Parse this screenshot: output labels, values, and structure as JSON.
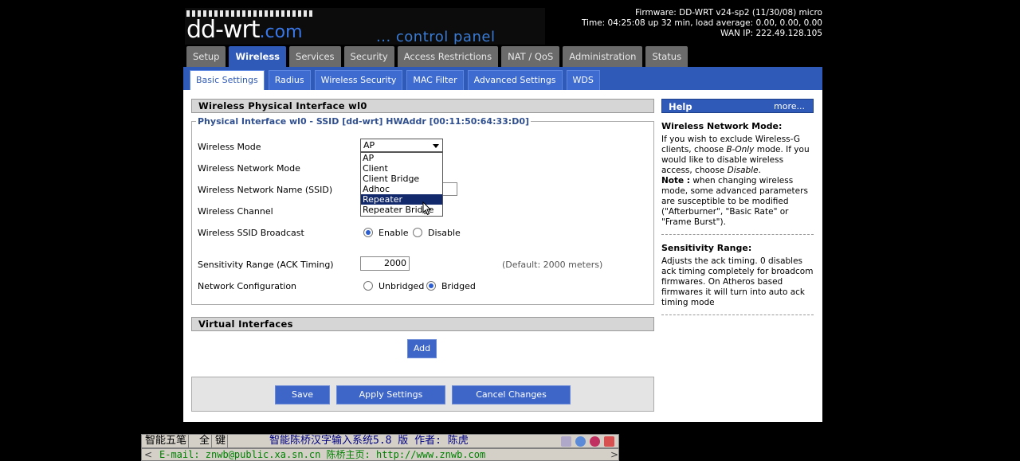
{
  "header": {
    "logo_main": "dd-wrt",
    "logo_com": ".com",
    "logo_sub": "... control panel",
    "firmware": "Firmware: DD-WRT v24-sp2 (11/30/08) micro",
    "time": "Time: 04:25:08 up 32 min, load average: 0.00, 0.00, 0.00",
    "wan_ip": "WAN IP: 222.49.128.105"
  },
  "main_tabs": [
    "Setup",
    "Wireless",
    "Services",
    "Security",
    "Access Restrictions",
    "NAT / QoS",
    "Administration",
    "Status"
  ],
  "sub_tabs": [
    "Basic Settings",
    "Radius",
    "Wireless Security",
    "MAC Filter",
    "Advanced Settings",
    "WDS"
  ],
  "section_title": "Wireless Physical Interface wl0",
  "legend": "Physical Interface wl0 - SSID [dd-wrt] HWAddr [00:11:50:64:33:D0]",
  "fields": {
    "mode_label": "Wireless Mode",
    "mode_value": "AP",
    "mode_options": [
      "AP",
      "Client",
      "Client Bridge",
      "Adhoc",
      "Repeater",
      "Repeater Bridge"
    ],
    "mode_highlighted": "Repeater",
    "netmode_label": "Wireless Network Mode",
    "ssid_label": "Wireless Network Name (SSID)",
    "channel_label": "Wireless Channel",
    "broadcast_label": "Wireless SSID Broadcast",
    "enable": "Enable",
    "disable": "Disable",
    "ack_label": "Sensitivity Range (ACK Timing)",
    "ack_value": "2000",
    "ack_default": "(Default: 2000 meters)",
    "netconf_label": "Network Configuration",
    "unbridged": "Unbridged",
    "bridged": "Bridged"
  },
  "virtual_title": "Virtual Interfaces",
  "buttons": {
    "add": "Add",
    "save": "Save",
    "apply": "Apply Settings",
    "cancel": "Cancel Changes"
  },
  "help": {
    "title": "Help",
    "more": "more...",
    "s1_title": "Wireless Network Mode:",
    "s1_text_a": "If you wish to exclude Wireless-G clients, choose ",
    "s1_em1": "B-Only",
    "s1_text_b": " mode. If you would like to disable wireless access, choose ",
    "s1_em2": "Disable",
    "s1_text_c": ".",
    "s1_note_label": "Note :",
    "s1_note": " when changing wireless mode, some advanced parameters are susceptible to be modified (\"Afterburner\", \"Basic Rate\" or \"Frame Burst\").",
    "s2_title": "Sensitivity Range:",
    "s2_text": "Adjusts the ack timing. 0 disables ack timing completely for broadcom firmwares. On Atheros based firmwares it will turn into auto ack timing mode"
  },
  "ime": {
    "cell1": "智能五笔",
    "cell2": "全",
    "cell3": "键",
    "title": "智能陈桥汉字输入系统5.8 版    作者: 陈虎",
    "line2": "E-mail: znwb@public.xa.sn.cn    陈桥主页: http://www.znwb.com",
    "left_arrow": "<",
    "right_arrow": ">"
  }
}
